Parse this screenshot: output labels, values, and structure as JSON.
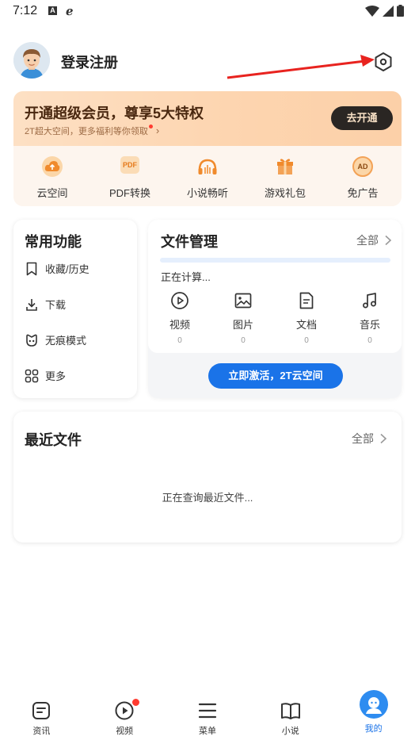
{
  "status_bar": {
    "time": "7:12",
    "left_icons": [
      "a-icon",
      "e-icon"
    ],
    "right_icons": [
      "wifi-icon",
      "signal-icon",
      "battery-icon"
    ]
  },
  "profile": {
    "login_label": "登录注册",
    "settings_icon": "settings-hexagon-icon"
  },
  "vip": {
    "title": "开通超级会员，尊享5大特权",
    "subtitle": "2T超大空间，更多福利等你领取",
    "button": "去开通",
    "features": [
      {
        "icon": "cloud-upload-icon",
        "label": "云空间"
      },
      {
        "icon": "pdf-icon",
        "icon_text": "PDF",
        "label": "PDF转换"
      },
      {
        "icon": "headphones-icon",
        "label": "小说畅听"
      },
      {
        "icon": "gift-icon",
        "label": "游戏礼包"
      },
      {
        "icon": "ad-free-icon",
        "icon_text": "AD",
        "label": "免广告"
      }
    ]
  },
  "common_functions": {
    "title": "常用功能",
    "items": [
      {
        "icon": "bookmark-icon",
        "label": "收藏/历史"
      },
      {
        "icon": "download-icon",
        "label": "下载"
      },
      {
        "icon": "incognito-icon",
        "label": "无痕模式"
      },
      {
        "icon": "grid-icon",
        "label": "更多"
      }
    ]
  },
  "file_management": {
    "title": "文件管理",
    "all_label": "全部",
    "status": "正在计算...",
    "progress": 0,
    "types": [
      {
        "icon": "video-icon",
        "label": "视频",
        "count": "0"
      },
      {
        "icon": "image-icon",
        "label": "图片",
        "count": "0"
      },
      {
        "icon": "document-icon",
        "label": "文档",
        "count": "0"
      },
      {
        "icon": "music-icon",
        "label": "音乐",
        "count": "0"
      }
    ],
    "activate_button": "立即激活，2T云空间"
  },
  "recent_files": {
    "title": "最近文件",
    "all_label": "全部",
    "loading": "正在查询最近文件..."
  },
  "bottom_nav": {
    "items": [
      {
        "icon": "news-icon",
        "label": "资讯"
      },
      {
        "icon": "play-icon",
        "label": "视频"
      },
      {
        "icon": "menu-icon",
        "label": "菜单"
      },
      {
        "icon": "book-icon",
        "label": "小说"
      },
      {
        "icon": "mine-avatar-icon",
        "label": "我的"
      }
    ],
    "active_index": 4
  },
  "colors": {
    "accent": "#1a73e8",
    "vip_banner": "#fdd5b0",
    "vip_button": "#2a2623",
    "badge_red": "#ff3b30"
  }
}
